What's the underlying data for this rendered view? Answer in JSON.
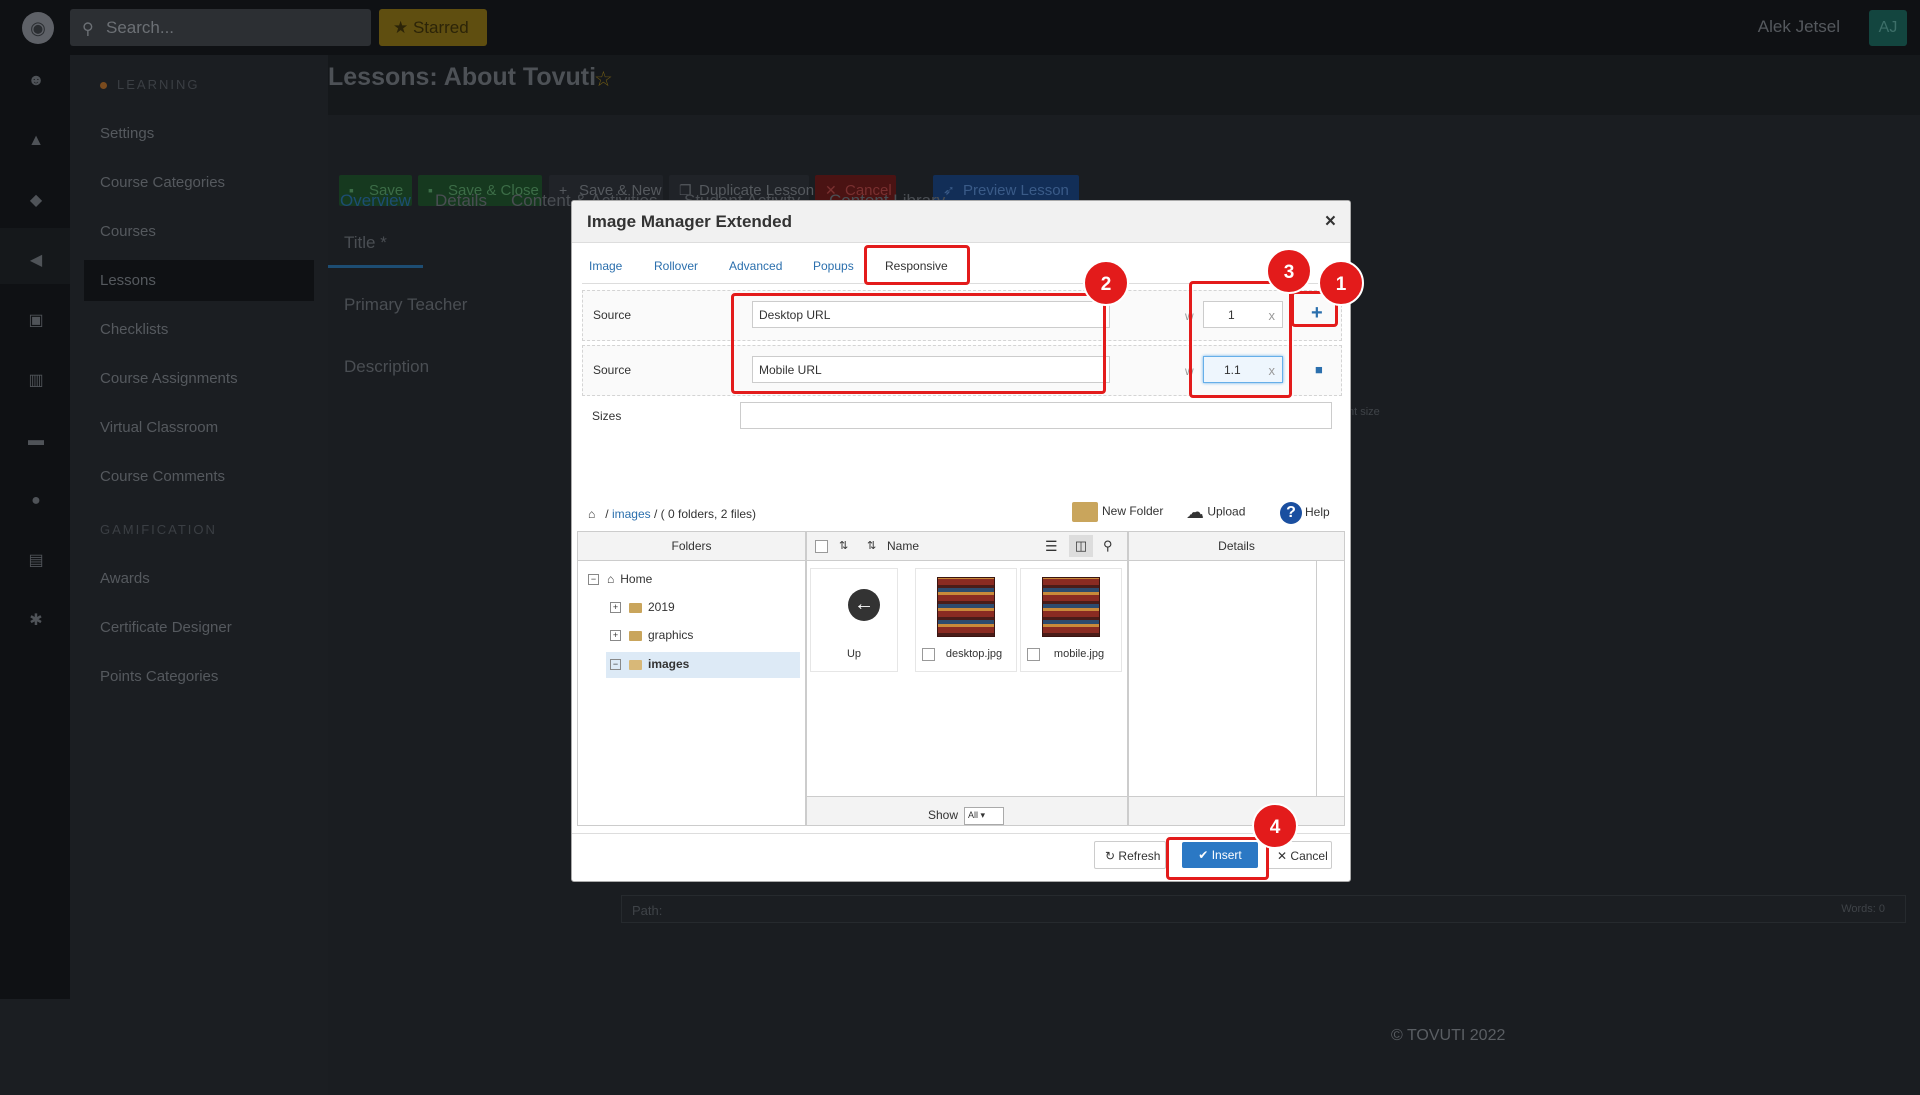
{
  "topbar": {
    "search_placeholder": "Search...",
    "starred_label": "Starred",
    "user_name": "Alek Jetsel",
    "avatar_initials": "AJ"
  },
  "sidebar": {
    "section_learning": "LEARNING",
    "items": [
      "Settings",
      "Course Categories",
      "Courses",
      "Lessons",
      "Checklists",
      "Course Assignments",
      "Virtual Classroom",
      "Course Comments"
    ],
    "section_gamification": "GAMIFICATION",
    "gam_items": [
      "Awards",
      "Certificate Designer",
      "Points Categories"
    ]
  },
  "page": {
    "title": "Lessons: About Tovuti",
    "toolbar": {
      "save": "Save",
      "save_close": "Save & Close",
      "save_new": "Save & New",
      "duplicate": "Duplicate Lesson",
      "cancel": "Cancel",
      "preview": "Preview Lesson"
    },
    "tabs": [
      "Overview",
      "Details",
      "Content & Activities",
      "Student Activity",
      "Content Library"
    ],
    "fields": {
      "title": "Title *",
      "teacher": "Primary Teacher",
      "description": "Description"
    },
    "editor_path": "Path:",
    "editor_words": "Words: 0",
    "editor_fontsize": "nt size",
    "footer": "© TOVUTI 2022"
  },
  "dialog": {
    "title": "Image Manager Extended",
    "close": "×",
    "tabs": [
      "Image",
      "Rollover",
      "Advanced",
      "Popups",
      "Responsive"
    ],
    "active_tab": "Responsive",
    "rows": [
      {
        "label": "Source",
        "url": "Desktop URL",
        "w": "w",
        "density": "1",
        "x": "x"
      },
      {
        "label": "Source",
        "url": "Mobile URL",
        "w": "w",
        "density": "1.1",
        "x": "x"
      }
    ],
    "sizes_label": "Sizes",
    "breadcrumb": {
      "path": "images",
      "sep": "/",
      "info": "( 0 folders, 2 files)"
    },
    "actions": {
      "new_folder": "New Folder",
      "upload": "Upload",
      "help": "Help"
    },
    "folders_header": "Folders",
    "name_header": "Name",
    "details_header": "Details",
    "tree": {
      "home": "Home",
      "folders": [
        "2019",
        "graphics",
        "images"
      ]
    },
    "files": [
      {
        "name": "Up"
      },
      {
        "name": "desktop.jpg"
      },
      {
        "name": "mobile.jpg"
      }
    ],
    "show_label": "Show",
    "show_value": "All",
    "refresh": "Refresh",
    "insert": "Insert",
    "cancel": "Cancel"
  },
  "callouts": [
    "1",
    "2",
    "3",
    "4"
  ],
  "colors": {
    "highlight": "#e31b1b",
    "primary": "#2b78c4",
    "link": "#2b6fad"
  }
}
